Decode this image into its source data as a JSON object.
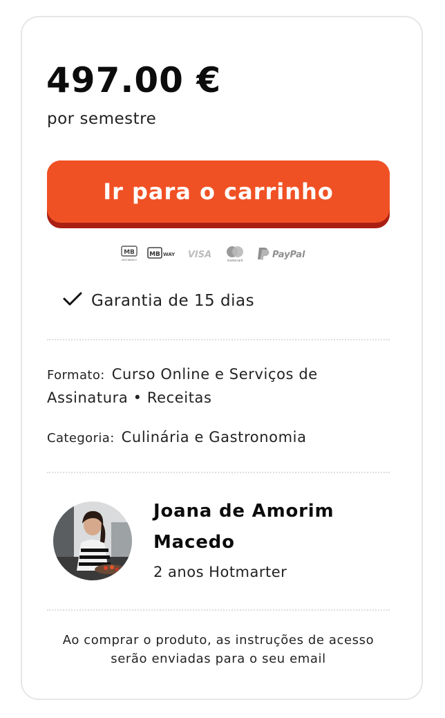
{
  "price": {
    "amount": "497.00 €",
    "period": "por semestre"
  },
  "cta": {
    "label": "Ir para o carrinho",
    "color": "#f05124",
    "shadow_color": "#a91f12"
  },
  "payment_methods": [
    {
      "icon": "multibanco-icon",
      "label": "MB",
      "sublabel": "MULTIBANCO"
    },
    {
      "icon": "mbway-icon",
      "label": "MB",
      "sublabel": "WAY"
    },
    {
      "icon": "visa-icon",
      "label": "VISA"
    },
    {
      "icon": "mastercard-icon",
      "label": "mastercard"
    },
    {
      "icon": "paypal-icon",
      "label": "PayPal"
    }
  ],
  "guarantee": {
    "icon": "checkmark-icon",
    "text": "Garantia de 15 dias"
  },
  "details": {
    "format_label": "Formato:",
    "format_value": "Curso Online e Serviços de Assinatura • Receitas",
    "category_label": "Categoria:",
    "category_value": "Culinária e Gastronomia"
  },
  "author": {
    "name": "Joana de Amorim Macedo",
    "meta": "2 anos Hotmarter",
    "avatar_icon": "author-avatar"
  },
  "note": "Ao comprar o produto, as instruções de acesso serão enviadas para o seu email"
}
